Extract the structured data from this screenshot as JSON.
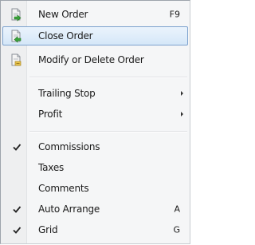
{
  "menu": {
    "items": [
      {
        "label": "New Order",
        "shortcut": "F9",
        "icon": "new-order-icon"
      },
      {
        "label": "Close Order",
        "icon": "close-order-icon",
        "highlighted": true
      },
      {
        "label": "Modify or Delete Order",
        "icon": "modify-order-icon"
      },
      {
        "label": "Trailing Stop",
        "submenu": true
      },
      {
        "label": "Profit",
        "submenu": true
      },
      {
        "label": "Commissions",
        "checked": true
      },
      {
        "label": "Taxes",
        "checked": false
      },
      {
        "label": "Comments",
        "checked": false
      },
      {
        "label": "Auto Arrange",
        "shortcut": "A",
        "checked": true
      },
      {
        "label": "Grid",
        "shortcut": "G",
        "checked": true
      }
    ]
  },
  "colors": {
    "highlight_border": "#7da2ce",
    "highlight_fill": "#d5e7f8",
    "icon_green": "#3aa33a",
    "doc_fill": "#f2f2f2",
    "modify_yellow": "#e8c44a"
  }
}
